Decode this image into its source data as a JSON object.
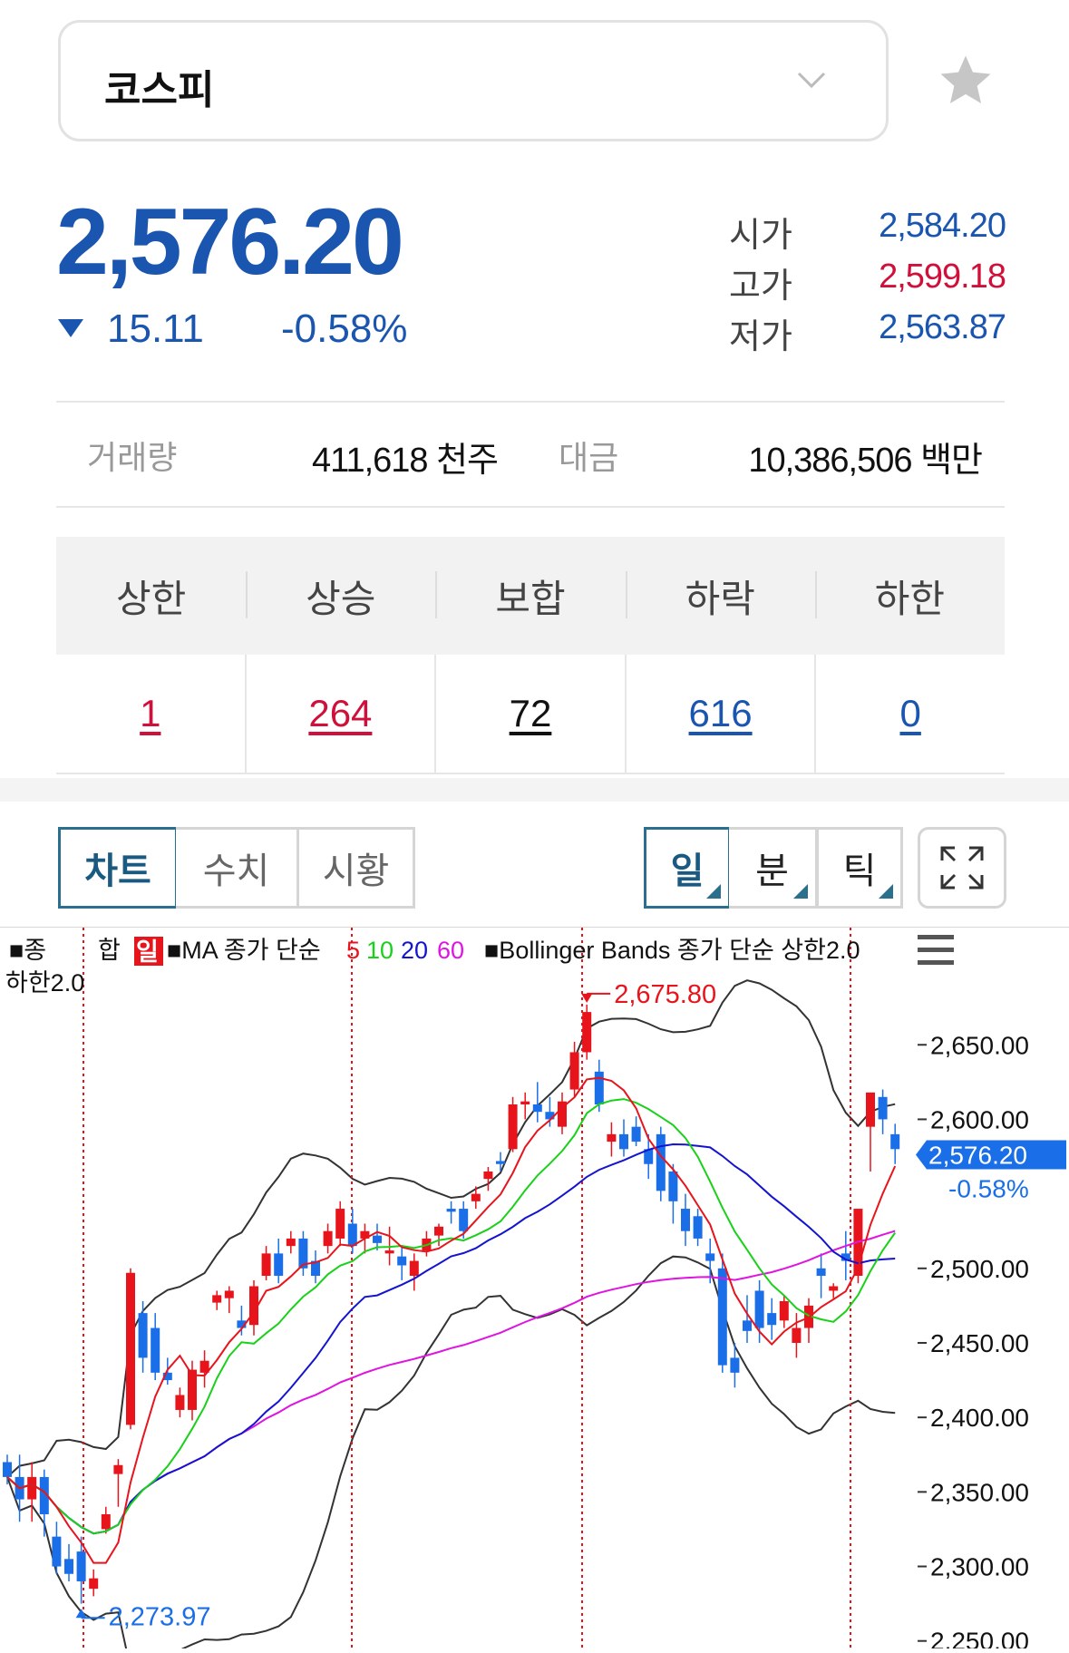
{
  "selector": {
    "label": "코스피"
  },
  "quote": {
    "price": "2,576.20",
    "change": "15.11",
    "change_pct": "-0.58%",
    "open_label": "시가",
    "open": "2,584.20",
    "high_label": "고가",
    "high": "2,599.18",
    "low_label": "저가",
    "low": "2,563.87"
  },
  "volume": {
    "vol_label": "거래량",
    "vol_value": "411,618 천주",
    "amt_label": "대금",
    "amt_value": "10,386,506 백만"
  },
  "breadth": {
    "headers": [
      "상한",
      "상승",
      "보합",
      "하락",
      "하한"
    ],
    "values": [
      "1",
      "264",
      "72",
      "616",
      "0"
    ],
    "colors": [
      "#d0103a",
      "#d0103a",
      "#111111",
      "#1a55b0",
      "#1a55b0"
    ]
  },
  "tabs": {
    "chart": "차트",
    "numeric": "수치",
    "market": "시황"
  },
  "periods": {
    "day": "일",
    "minute": "분",
    "tick": "틱"
  },
  "colors": {
    "up": "#e8141c",
    "down": "#1a6fe8",
    "price_blue": "#1a55b0",
    "price_red": "#d0103a",
    "ma5": "#e8141c",
    "ma10": "#1ad11a",
    "ma20": "#1414d0",
    "ma60": "#e014e0",
    "band": "#333333"
  },
  "chart_data": {
    "type": "candlestick",
    "legend": {
      "series": "■종",
      "series2": "합",
      "period": "일",
      "ma": "■MA 종가 단순",
      "ma5": "5",
      "ma10": "10",
      "ma20": "20",
      "ma60": "60",
      "bb": "■Bollinger Bands 종가 단순 상한2.0",
      "bb2": "하한2.0"
    },
    "y_ticks": [
      "2,650.00",
      "2,600.00",
      "2,500.00",
      "2,450.00",
      "2,400.00",
      "2,350.00",
      "2,300.00",
      "2,250.00"
    ],
    "y_tick_values": [
      2650,
      2600,
      2500,
      2450,
      2400,
      2350,
      2300,
      2250
    ],
    "ylim": [
      2248,
      2697
    ],
    "last_price_label": "2,576.20",
    "last_change_label": "-0.58%",
    "high_annotation": "2,675.80",
    "low_annotation": "2,273.97",
    "candles": [
      [
        2370,
        2375,
        2355,
        2360
      ],
      [
        2360,
        2375,
        2330,
        2345
      ],
      [
        2345,
        2370,
        2330,
        2360
      ],
      [
        2360,
        2365,
        2320,
        2335
      ],
      [
        2320,
        2330,
        2295,
        2300
      ],
      [
        2305,
        2315,
        2290,
        2295
      ],
      [
        2310,
        2320,
        2275,
        2290
      ],
      [
        2285,
        2298,
        2280,
        2292
      ],
      [
        2325,
        2340,
        2322,
        2335
      ],
      [
        2362,
        2372,
        2340,
        2368
      ],
      [
        2395,
        2500,
        2392,
        2497
      ],
      [
        2470,
        2478,
        2430,
        2440
      ],
      [
        2460,
        2470,
        2425,
        2430
      ],
      [
        2430,
        2440,
        2422,
        2425
      ],
      [
        2405,
        2420,
        2400,
        2415
      ],
      [
        2405,
        2438,
        2398,
        2432
      ],
      [
        2430,
        2445,
        2420,
        2438
      ],
      [
        2477,
        2485,
        2472,
        2482
      ],
      [
        2480,
        2488,
        2470,
        2485
      ],
      [
        2465,
        2475,
        2455,
        2460
      ],
      [
        2462,
        2492,
        2455,
        2488
      ],
      [
        2495,
        2515,
        2492,
        2510
      ],
      [
        2510,
        2520,
        2490,
        2495
      ],
      [
        2515,
        2525,
        2510,
        2520
      ],
      [
        2520,
        2525,
        2495,
        2500
      ],
      [
        2505,
        2512,
        2490,
        2495
      ],
      [
        2515,
        2530,
        2510,
        2525
      ],
      [
        2520,
        2545,
        2515,
        2540
      ],
      [
        2530,
        2540,
        2510,
        2515
      ],
      [
        2520,
        2530,
        2510,
        2525
      ],
      [
        2522,
        2530,
        2512,
        2517
      ],
      [
        2510,
        2528,
        2502,
        2512
      ],
      [
        2508,
        2515,
        2492,
        2502
      ],
      [
        2495,
        2510,
        2485,
        2505
      ],
      [
        2512,
        2525,
        2508,
        2520
      ],
      [
        2522,
        2530,
        2515,
        2528
      ],
      [
        2540,
        2545,
        2530,
        2538
      ],
      [
        2540,
        2545,
        2520,
        2525
      ],
      [
        2545,
        2555,
        2540,
        2550
      ],
      [
        2560,
        2568,
        2552,
        2565
      ],
      [
        2572,
        2578,
        2565,
        2570
      ],
      [
        2580,
        2615,
        2578,
        2610
      ],
      [
        2610,
        2618,
        2600,
        2612
      ],
      [
        2610,
        2625,
        2598,
        2605
      ],
      [
        2605,
        2615,
        2595,
        2600
      ],
      [
        2595,
        2618,
        2590,
        2612
      ],
      [
        2620,
        2652,
        2615,
        2645
      ],
      [
        2645,
        2677,
        2640,
        2672
      ],
      [
        2632,
        2640,
        2605,
        2610
      ],
      [
        2585,
        2598,
        2575,
        2590
      ],
      [
        2590,
        2600,
        2575,
        2580
      ],
      [
        2595,
        2602,
        2582,
        2585
      ],
      [
        2580,
        2590,
        2560,
        2570
      ],
      [
        2590,
        2595,
        2545,
        2552
      ],
      [
        2565,
        2570,
        2530,
        2545
      ],
      [
        2540,
        2550,
        2515,
        2525
      ],
      [
        2535,
        2540,
        2515,
        2520
      ],
      [
        2510,
        2520,
        2490,
        2505
      ],
      [
        2500,
        2510,
        2430,
        2435
      ],
      [
        2440,
        2450,
        2420,
        2430
      ],
      [
        2465,
        2482,
        2450,
        2458
      ],
      [
        2485,
        2492,
        2450,
        2460
      ],
      [
        2470,
        2480,
        2452,
        2462
      ],
      [
        2465,
        2482,
        2460,
        2478
      ],
      [
        2450,
        2470,
        2440,
        2460
      ],
      [
        2460,
        2480,
        2450,
        2475
      ],
      [
        2500,
        2510,
        2480,
        2495
      ],
      [
        2485,
        2490,
        2480,
        2488
      ],
      [
        2510,
        2525,
        2492,
        2505
      ],
      [
        2495,
        2530,
        2490,
        2540
      ],
      [
        2595,
        2600,
        2565,
        2618
      ],
      [
        2615,
        2620,
        2590,
        2600
      ],
      [
        2590,
        2597,
        2570,
        2580
      ]
    ]
  }
}
